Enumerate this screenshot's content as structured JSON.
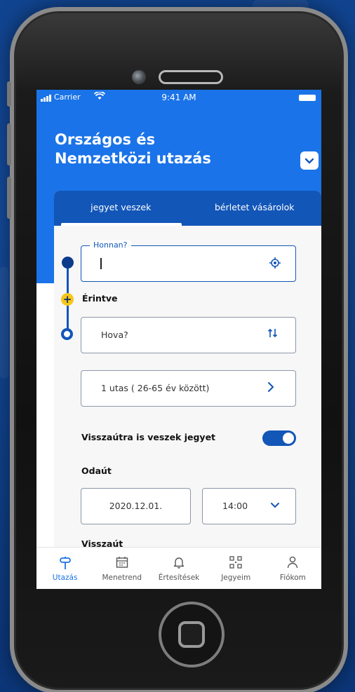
{
  "status_bar": {
    "carrier": "Carrier",
    "time": "9:41 AM"
  },
  "header": {
    "title": "Országos és\nNemzetközi utazás"
  },
  "tabs": [
    {
      "label": "jegyet veszek",
      "active": true
    },
    {
      "label": "bérletet vásárolok",
      "active": false
    }
  ],
  "form": {
    "from_label": "Honnan?",
    "from_value": "",
    "via_label": "Érintve",
    "to_placeholder": "Hova?",
    "passengers": "1 utas ( 26-65 év között)",
    "return_ticket_label": "Visszaútra is veszek jegyet",
    "return_ticket_enabled": true,
    "outbound_label": "Odaút",
    "outbound_date": "2020.12.01.",
    "outbound_time": "14:00",
    "return_label": "Visszaút"
  },
  "bottom_nav": [
    {
      "label": "Utazás",
      "icon": "signpost-icon",
      "active": true
    },
    {
      "label": "Menetrend",
      "icon": "calendar-icon",
      "active": false
    },
    {
      "label": "Értesítések",
      "icon": "bell-icon",
      "active": false
    },
    {
      "label": "Jegyeim",
      "icon": "qr-code-icon",
      "active": false
    },
    {
      "label": "Fiókom",
      "icon": "user-icon",
      "active": false
    }
  ],
  "colors": {
    "primary_blue": "#1a73e8",
    "dark_blue": "#1256b8",
    "accent_yellow": "#f6c719"
  }
}
